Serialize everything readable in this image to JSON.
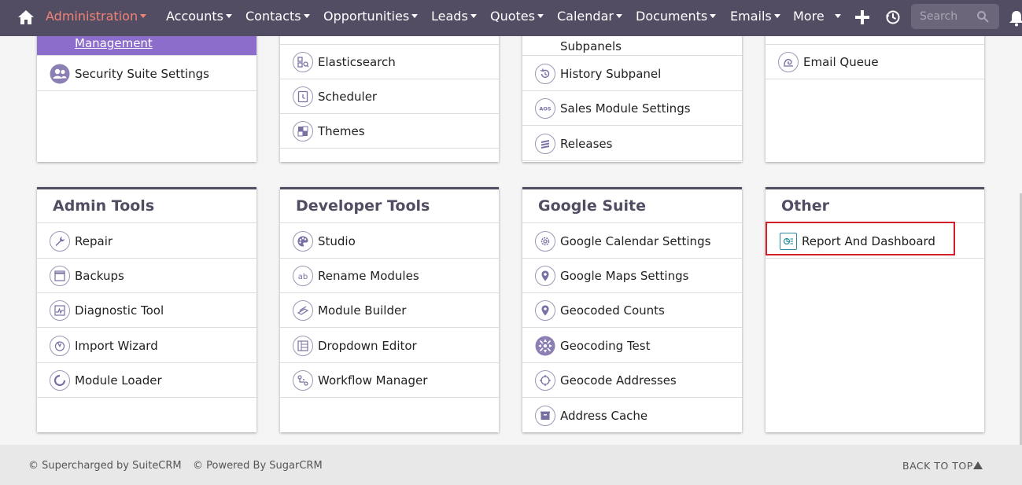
{
  "nav": {
    "items": [
      {
        "label": "Administration",
        "active": true
      },
      {
        "label": "Accounts"
      },
      {
        "label": "Contacts"
      },
      {
        "label": "Opportunities"
      },
      {
        "label": "Leads"
      },
      {
        "label": "Quotes"
      },
      {
        "label": "Calendar"
      },
      {
        "label": "Documents"
      },
      {
        "label": "Emails"
      },
      {
        "label": "More"
      }
    ],
    "search_placeholder": "Search",
    "icons": [
      "home-icon",
      "plus-icon",
      "history-icon",
      "search-icon",
      "bell-icon"
    ],
    "active_color": "#f08377",
    "bg_color": "#534d64"
  },
  "top_panels": [
    {
      "items": [
        {
          "label": "Management",
          "icon": "user-management-icon",
          "highlighted": true
        },
        {
          "label": "Security Suite Settings",
          "icon": "users-icon"
        }
      ]
    },
    {
      "items": [
        {
          "label": "Elasticsearch",
          "icon": "elasticsearch-icon"
        },
        {
          "label": "Scheduler",
          "icon": "clock-icon"
        },
        {
          "label": "Themes",
          "icon": "themes-icon"
        }
      ]
    },
    {
      "items": [
        {
          "label": "Subpanels",
          "icon": "subpanels-icon"
        },
        {
          "label": "History Subpanel",
          "icon": "history-icon"
        },
        {
          "label": "Sales Module Settings",
          "icon": "aos-icon"
        },
        {
          "label": "Releases",
          "icon": "releases-icon"
        }
      ]
    },
    {
      "items": [
        {
          "label": "Email Queue",
          "icon": "email-queue-icon"
        }
      ]
    }
  ],
  "sections": [
    {
      "title": "Admin Tools",
      "items": [
        {
          "label": "Repair",
          "icon": "wrench-icon"
        },
        {
          "label": "Backups",
          "icon": "backups-icon"
        },
        {
          "label": "Diagnostic Tool",
          "icon": "diagnostic-icon"
        },
        {
          "label": "Import Wizard",
          "icon": "import-wizard-icon"
        },
        {
          "label": "Module Loader",
          "icon": "module-loader-icon"
        }
      ]
    },
    {
      "title": "Developer Tools",
      "items": [
        {
          "label": "Studio",
          "icon": "palette-icon"
        },
        {
          "label": "Rename Modules",
          "icon": "rename-icon"
        },
        {
          "label": "Module Builder",
          "icon": "module-builder-icon"
        },
        {
          "label": "Dropdown Editor",
          "icon": "dropdown-editor-icon"
        },
        {
          "label": "Workflow Manager",
          "icon": "workflow-icon"
        }
      ]
    },
    {
      "title": "Google Suite",
      "items": [
        {
          "label": "Google Calendar Settings",
          "icon": "gear-icon"
        },
        {
          "label": "Google Maps Settings",
          "icon": "map-pin-icon"
        },
        {
          "label": "Geocoded Counts",
          "icon": "map-pin-icon"
        },
        {
          "label": "Geocoding Test",
          "icon": "geocoding-test-icon"
        },
        {
          "label": "Geocode Addresses",
          "icon": "crosshair-icon"
        },
        {
          "label": "Address Cache",
          "icon": "address-cache-icon"
        }
      ]
    },
    {
      "title": "Other",
      "items": [
        {
          "label": "Report And Dashboard",
          "icon": "report-dashboard-icon"
        }
      ]
    }
  ],
  "footer": {
    "supercharged": "© Supercharged by SuiteCRM",
    "powered": "© Powered By SugarCRM",
    "back_to_top": "BACK TO TOP"
  }
}
